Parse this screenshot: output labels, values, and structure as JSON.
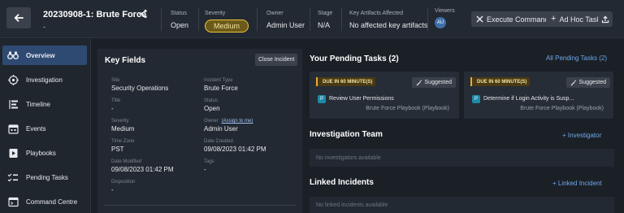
{
  "header": {
    "incident_title": "20230908-1: Brute Force",
    "incident_sub": "-",
    "status_label": "Status",
    "status_value": "Open",
    "severity_label": "Severity",
    "severity_value": "Medium",
    "owner_label": "Owner",
    "owner_value": "Admin User",
    "stage_label": "Stage",
    "stage_value": "N/A",
    "artifacts_label": "Key Artifacts Affected",
    "artifacts_value": "No affected key artifacts",
    "viewers_label": "Viewers",
    "viewer_initials": "AU",
    "execute_command_label": "Execute Command",
    "adhoc_task_label": "Ad Hoc Task"
  },
  "sidebar": {
    "items": [
      {
        "label": "Overview",
        "icon": "binoculars-icon",
        "active": true
      },
      {
        "label": "Investigation",
        "icon": "crosshair-icon",
        "active": false
      },
      {
        "label": "Timeline",
        "icon": "timeline-icon",
        "active": false
      },
      {
        "label": "Events",
        "icon": "calendar-icon",
        "active": false
      },
      {
        "label": "Playbooks",
        "icon": "playbook-icon",
        "active": false
      },
      {
        "label": "Pending Tasks",
        "icon": "checklist-icon",
        "active": false
      },
      {
        "label": "Command Centre",
        "icon": "terminal-icon",
        "active": false
      }
    ]
  },
  "key_fields": {
    "title": "Key Fields",
    "close_button": "Close Incident",
    "fields": {
      "site": {
        "label": "Site",
        "value": "Security Operations"
      },
      "incident_type": {
        "label": "Incident Type",
        "value": "Brute Force"
      },
      "title": {
        "label": "Title",
        "value": "-"
      },
      "status": {
        "label": "Status",
        "value": "Open"
      },
      "severity": {
        "label": "Severity",
        "value": "Medium"
      },
      "owner": {
        "label": "Owner",
        "value": "Admin User",
        "link": "(Assign to me)"
      },
      "time_zone": {
        "label": "Time Zone",
        "value": "PST"
      },
      "date_created": {
        "label": "Date Created",
        "value": "09/08/2023 01:42 PM"
      },
      "date_modified": {
        "label": "Date Modified",
        "value": "09/08/2023 01:42 PM"
      },
      "tags": {
        "label": "Tags",
        "value": "-"
      },
      "disposition": {
        "label": "Disposition",
        "value": "-"
      }
    }
  },
  "pending_tasks": {
    "title": "Your Pending Tasks (2)",
    "all_link": "All Pending Tasks (2)",
    "tasks": [
      {
        "due": "DUE IN 60 MINUTE(S)",
        "suggested": "Suggested",
        "name": "Review User Permissions",
        "playbook": "Brute Force Playbook (Playbook)"
      },
      {
        "due": "DUE IN 60 MINUTE(S)",
        "suggested": "Suggested",
        "name": "Determine if Login Activity is Susp...",
        "playbook": "Brute Force Playbook (Playbook)"
      }
    ]
  },
  "investigation_team": {
    "title": "Investigation Team",
    "add_link": "+ Investigator",
    "empty": "No investigators available"
  },
  "linked_incidents": {
    "title": "Linked Incidents",
    "add_link": "+ Linked Incident",
    "empty": "No linked incidents available"
  },
  "colors": {
    "accent": "#2e4a73",
    "link": "#6fa8e8",
    "severity_medium": "#f0c53a",
    "due_badge": "#f0a830"
  }
}
